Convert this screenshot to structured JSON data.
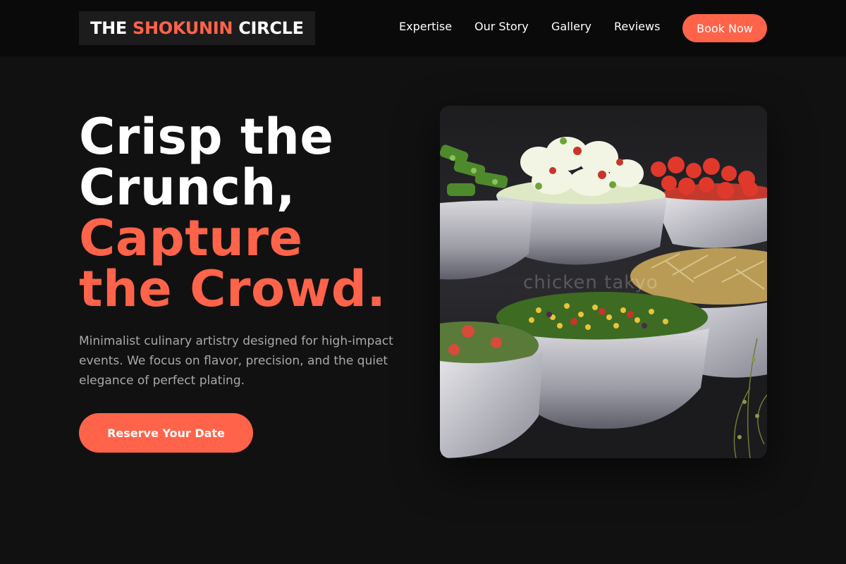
{
  "header": {
    "logo": {
      "part1": "THE",
      "part2": "SHOKUNIN",
      "part3": "CIRCLE"
    },
    "nav": [
      "Expertise",
      "Our Story",
      "Gallery",
      "Reviews"
    ],
    "cta": "Book Now"
  },
  "hero": {
    "headline": {
      "line1": "Crisp the",
      "line2": "Crunch,",
      "line3": "Capture",
      "line4": "the Crowd."
    },
    "description": "Minimalist culinary artistry designed for high-impact events. We focus on flavor, precision, and the quiet elegance of perfect plating.",
    "cta": "Reserve Your Date",
    "image": {
      "icon": "salad-bowls-photo",
      "watermark": "chicken takyo"
    }
  },
  "colors": {
    "accent": "#ff634a",
    "background": "#111111",
    "header": "#0a0a0a",
    "muted_text": "#a9a9a9"
  }
}
